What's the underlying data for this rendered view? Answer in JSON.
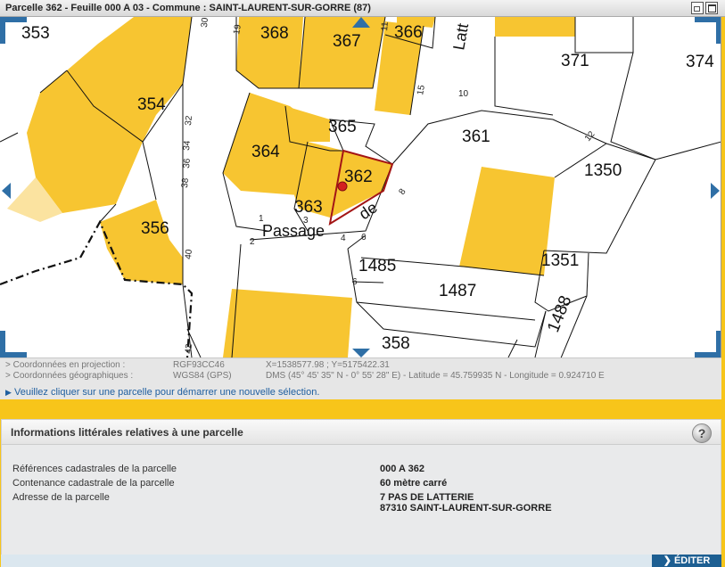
{
  "window": {
    "title": "Parcelle 362 - Feuille 000 A 03 - Commune : SAINT-LAURENT-SUR-GORRE (87)"
  },
  "map": {
    "selected_parcel": "362",
    "colors": {
      "building": "#f7c531",
      "selected": "#a31515",
      "line": "#111111"
    },
    "parcels": [
      "353",
      "368",
      "367",
      "366",
      "371",
      "374",
      "354",
      "365",
      "361",
      "364",
      "362",
      "1350",
      "363",
      "356",
      "1485",
      "1351",
      "1487",
      "1488",
      "358"
    ],
    "streets": [
      "Passage",
      "de",
      "Latt"
    ],
    "street_numbers": [
      "30",
      "19",
      "11",
      "15",
      "10",
      "12",
      "34",
      "36",
      "38",
      "32",
      "1",
      "3",
      "2",
      "4",
      "6",
      "8",
      "40",
      "42",
      "6"
    ]
  },
  "coordinates": {
    "projection_label": "> Coordonnées en projection :",
    "projection_system": "RGF93CC46",
    "projection_value": "X=1538577.98 ; Y=5175422.31",
    "geo_label": "> Coordonnées géographiques :",
    "geo_system": "WGS84 (GPS)",
    "geo_value": "DMS (45° 45' 35\" N - 0° 55' 28\" E) - Latitude = 45.759935 N - Longitude = 0.924710 E",
    "hint": "Veuillez cliquer sur une parcelle pour démarrer une nouvelle sélection."
  },
  "panel": {
    "title": "Informations littérales relatives à une parcelle",
    "rows": [
      {
        "label": "Références cadastrales de la parcelle",
        "value": "000 A 362"
      },
      {
        "label": "Contenance cadastrale de la parcelle",
        "value": "60 mètre carré"
      },
      {
        "label": "Adresse de la parcelle",
        "value": "7 PAS DE LATTERIE",
        "value2": "87310 SAINT-LAURENT-SUR-GORRE"
      }
    ],
    "help_icon": "question-icon",
    "edit_label": "ÉDITER"
  }
}
